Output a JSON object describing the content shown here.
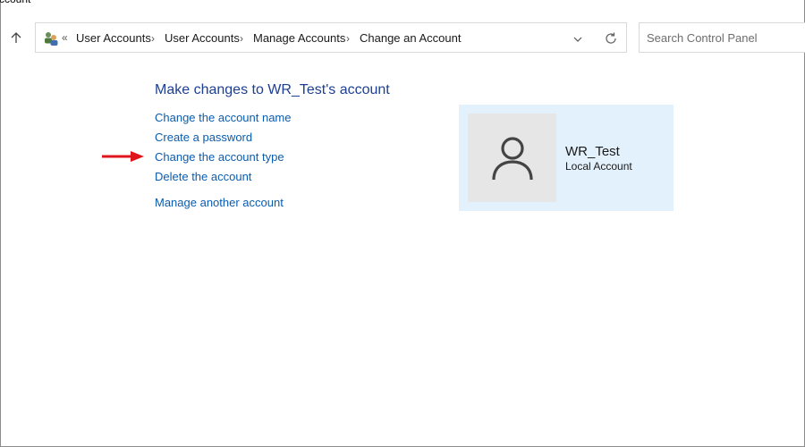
{
  "window": {
    "title_fragment": "ccount"
  },
  "address_bar": {
    "overflow": "«",
    "crumbs": [
      "User Accounts",
      "User Accounts",
      "Manage Accounts",
      "Change an Account"
    ]
  },
  "search": {
    "placeholder": "Search Control Panel"
  },
  "main": {
    "heading": "Make changes to WR_Test's account",
    "links": {
      "change_name": "Change the account name",
      "create_password": "Create a password",
      "change_type": "Change the account type",
      "delete": "Delete the account",
      "manage_another": "Manage another account"
    },
    "annotation_color": "#e0151b"
  },
  "account": {
    "name": "WR_Test",
    "type": "Local Account"
  },
  "colors": {
    "link": "#0b5cad",
    "heading": "#1c3f94",
    "card_bg": "#e3f1fc"
  }
}
